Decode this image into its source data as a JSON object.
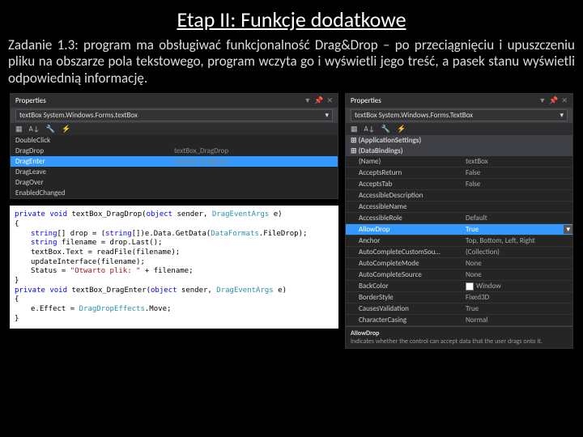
{
  "title": "Etap II: Funkcje dodatkowe",
  "desc": "Zadanie 1.3: program ma obsługiwać funkcjonalność Drag&Drop – po przeciągnięciu i upuszczeniu pliku na obszarze pola tekstowego, program wczyta go i wyświetli jego treść, a pasek stanu wyświetli odpowiednią informację.",
  "evPanel": {
    "hdr": "Properties",
    "obj": "textBox System.Windows.Forms.textBox",
    "rows": [
      {
        "n": "DoubleClick",
        "v": ""
      },
      {
        "n": "DragDrop",
        "v": "textBox_DragDrop"
      },
      {
        "n": "DragEnter",
        "v": "textBox_DragEnter",
        "sel": true
      },
      {
        "n": "DragLeave",
        "v": ""
      },
      {
        "n": "DragOver",
        "v": ""
      },
      {
        "n": "EnabledChanged",
        "v": ""
      }
    ]
  },
  "code": {
    "sig1a": "private void",
    "sig1b": " textBox_DragDrop(",
    "sig1c": "object",
    "sig1d": " sender, ",
    "sig1e": "DragEventArgs",
    "sig1f": " e)",
    "l1a": "string",
    "l1b": "[] drop = (",
    "l1c": "string",
    "l1d": "[])e.Data.GetData(",
    "l1e": "DataFormats",
    "l1f": ".FileDrop);",
    "l2a": "string",
    "l2b": " filename = drop.Last();",
    "l3": "textBox.Text = readFile(filename);",
    "l4": "updateInterface(filename);",
    "l5a": "Status = ",
    "l5b": "\"Otwarto plik: \"",
    "l5c": " + filename;",
    "sig2a": "private void",
    "sig2b": " textBox_DragEnter(",
    "sig2c": "object",
    "sig2d": " sender, ",
    "sig2e": "DragEventArgs",
    "sig2f": " e)",
    "l6a": "e.Effect = ",
    "l6b": "DragDropEffects",
    "l6c": ".Move;"
  },
  "propPanel": {
    "hdr": "Properties",
    "obj": "textBox System.Windows.Forms.TextBox",
    "cats": {
      "a": "(ApplicationSettings)",
      "b": "(DataBindings)"
    },
    "rows": [
      {
        "n": "(Name)",
        "v": "textBox"
      },
      {
        "n": "AcceptsReturn",
        "v": "False"
      },
      {
        "n": "AcceptsTab",
        "v": "False"
      },
      {
        "n": "AccessibleDescription",
        "v": ""
      },
      {
        "n": "AccessibleName",
        "v": ""
      },
      {
        "n": "AccessibleRole",
        "v": "Default"
      },
      {
        "n": "AllowDrop",
        "v": "True",
        "hl": true
      },
      {
        "n": "Anchor",
        "v": "Top, Bottom, Left, Right"
      },
      {
        "n": "AutoCompleteCustomSou…",
        "v": "(Collection)"
      },
      {
        "n": "AutoCompleteMode",
        "v": "None"
      },
      {
        "n": "AutoCompleteSource",
        "v": "None"
      },
      {
        "n": "BackColor",
        "v": "Window",
        "c": "#fff"
      },
      {
        "n": "BorderStyle",
        "v": "Fixed3D"
      },
      {
        "n": "CausesValidation",
        "v": "True"
      },
      {
        "n": "CharacterCasing",
        "v": "Normal"
      }
    ],
    "help": {
      "t": "AllowDrop",
      "d": "Indicates whether the control can accept data that the user drags onto it."
    }
  }
}
